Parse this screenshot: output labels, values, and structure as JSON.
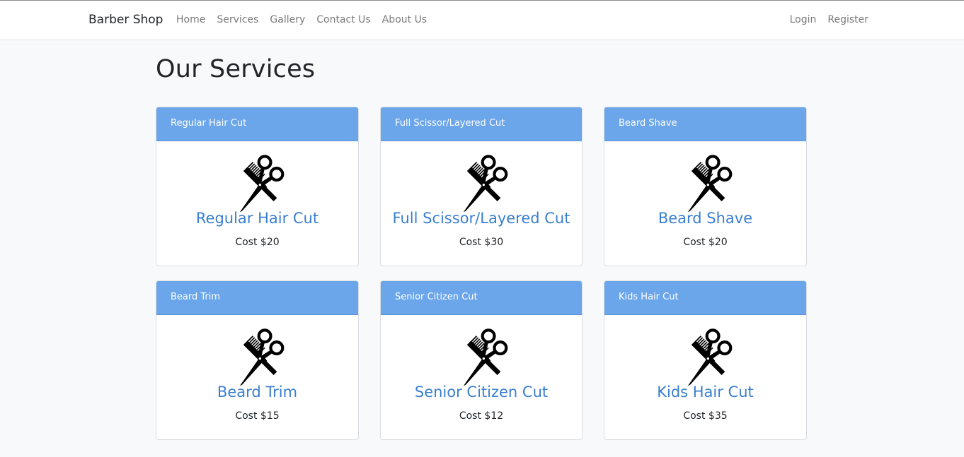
{
  "navbar": {
    "brand": "Barber Shop",
    "left_links": [
      "Home",
      "Services",
      "Gallery",
      "Contact Us",
      "About Us"
    ],
    "right_links": [
      "Login",
      "Register"
    ]
  },
  "page": {
    "title": "Our Services"
  },
  "services": [
    {
      "header": "Regular Hair Cut",
      "title": "Regular Hair Cut",
      "cost": "Cost $20",
      "icon": "scissors-comb-icon"
    },
    {
      "header": "Full Scissor/Layered Cut",
      "title": "Full Scissor/Layered Cut",
      "cost": "Cost $30",
      "icon": "scissors-comb-icon"
    },
    {
      "header": "Beard Shave",
      "title": "Beard Shave",
      "cost": "Cost $20",
      "icon": "scissors-comb-icon"
    },
    {
      "header": "Beard Trim",
      "title": "Beard Trim",
      "cost": "Cost $15",
      "icon": "scissors-comb-icon"
    },
    {
      "header": "Senior Citizen Cut",
      "title": "Senior Citizen Cut",
      "cost": "Cost $12",
      "icon": "scissors-comb-icon"
    },
    {
      "header": "Kids Hair Cut",
      "title": "Kids Hair Cut",
      "cost": "Cost $35",
      "icon": "scissors-comb-icon"
    }
  ],
  "colors": {
    "card_header": "#6ba5ea",
    "link": "#3a7fd0",
    "background": "#f8f9fa"
  }
}
